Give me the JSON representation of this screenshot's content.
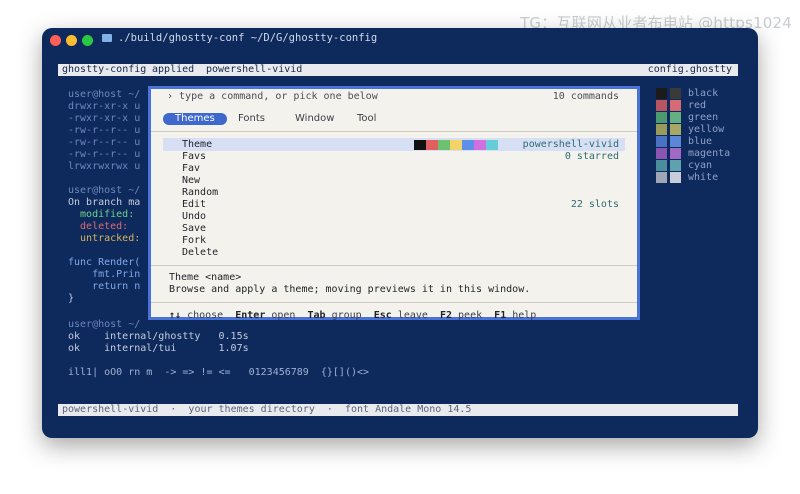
{
  "watermark": "TG：互联网从业者布电站 @https1024",
  "window": {
    "title": "./build/ghostty-conf ~/D/G/ghostty-config"
  },
  "header": {
    "left_prefix": "ghostty-config",
    "left_middle": " applied ",
    "left_theme": "powershell-vivid",
    "right": "config.ghostty"
  },
  "terminal": {
    "prompt1": "user@host ~/",
    "ls_rows": [
      "drwxr-xr-x u",
      "-rwxr-xr-x u",
      "-rw-r--r-- u",
      "-rw-r--r-- u",
      "-rw-r--r-- u",
      "lrwxrwxrwx u"
    ],
    "prompt2": "user@host ~/",
    "branch": "On branch ma",
    "modified": "  modified:",
    "deleted": "  deleted:",
    "untracked": "  untracked:",
    "func_line": "func Render(",
    "fmt_line": "    fmt.Prin",
    "return_line": "    return n",
    "brace": "}",
    "prompt3": "user@host ~/",
    "ok1": "ok    internal/ghostty   0.15s",
    "ok2": "ok    internal/tui       1.07s",
    "glyphs": "ill1| oO0 rn m  -> => != <=   0123456789  {}[]()<>"
  },
  "palette_legend": [
    {
      "label": "black",
      "color": "#1b1b1b"
    },
    {
      "label": "red",
      "color": "#b85560"
    },
    {
      "label": "green",
      "color": "#4e9a70"
    },
    {
      "label": "yellow",
      "color": "#9a9a5a"
    },
    {
      "label": "blue",
      "color": "#4a72c4"
    },
    {
      "label": "magenta",
      "color": "#8a55b0"
    },
    {
      "label": "cyan",
      "color": "#4a8e9e"
    },
    {
      "label": "white",
      "color": "#9ea6b8"
    }
  ],
  "legend_bright": [
    "#3a3a3a",
    "#d66b75",
    "#62b083",
    "#a8a866",
    "#5c86d8",
    "#a06ac4",
    "#5ea2b0",
    "#c6ccd8"
  ],
  "command_palette": {
    "prompt": "› type a command, or pick one below",
    "count": "10 commands",
    "tabs": [
      "Themes",
      "Fonts",
      "Window",
      "Tool"
    ],
    "items": [
      "Theme",
      "Favs",
      "Fav",
      "New",
      "Random",
      "Edit",
      "Undo",
      "Save",
      "Fork",
      "Delete"
    ],
    "selected_meta": "powershell-vivid",
    "favs_meta": "0 starred",
    "edit_meta": "22 slots",
    "swatches": [
      "#111111",
      "#e06060",
      "#6cc070",
      "#f2d36a",
      "#5f8fe8",
      "#d070e0",
      "#66ccd8"
    ],
    "detail_title": "Theme <name>",
    "detail_desc": "Browse and apply a theme; moving previews it in this window.",
    "footer": {
      "k1": "↑↓",
      "d1": " choose  ",
      "k2": "Enter",
      "d2": " open  ",
      "k3": "Tab",
      "d3": " group  ",
      "k4": "Esc",
      "d4": " leave  ",
      "k5": "F2",
      "d5": " peek  ",
      "k6": "F1",
      "d6": " help"
    }
  },
  "statusbar": "powershell-vivid  ·  your themes directory  ·  font Andale Mono 14.5"
}
